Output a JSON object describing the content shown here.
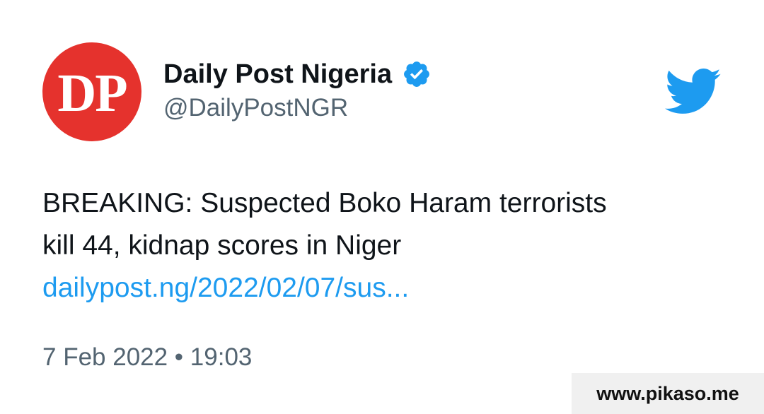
{
  "author": {
    "avatar_text": "DP",
    "display_name": "Daily Post Nigeria",
    "handle": "@DailyPostNGR",
    "verified": true,
    "avatar_color": "#e5322d",
    "verified_color": "#1d9bf0"
  },
  "platform_icon": "twitter-bird-icon",
  "tweet": {
    "text_line_1": "BREAKING: Suspected Boko Haram terrorists",
    "text_line_2": "kill 44, kidnap scores in Niger",
    "link": "dailypost.ng/2022/02/07/sus..."
  },
  "timestamp": "7 Feb 2022 • 19:03",
  "watermark": "www.pikaso.me",
  "colors": {
    "text": "#0f1419",
    "secondary_text": "#536471",
    "link": "#1d9bf0",
    "twitter_blue": "#1d9bf0"
  }
}
